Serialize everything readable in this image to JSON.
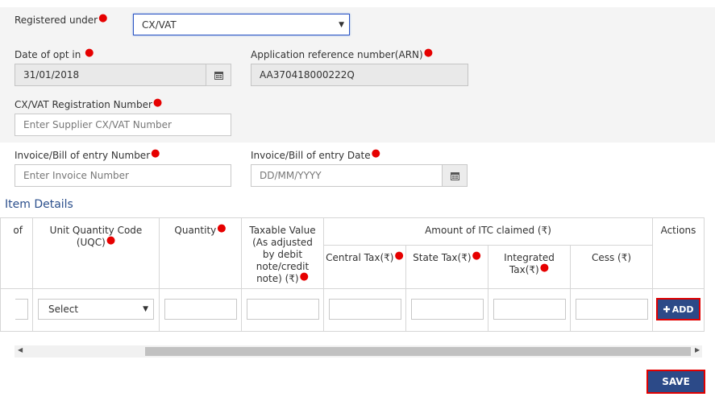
{
  "form": {
    "registered_under": {
      "label": "Registered under",
      "value": "CX/VAT"
    },
    "date_of_opt_in": {
      "label": "Date of opt in",
      "value": "31/01/2018"
    },
    "arn": {
      "label": "Application reference number(ARN)",
      "value": "AA370418000222Q"
    },
    "cx_vat_reg": {
      "label": "CX/VAT Registration Number",
      "placeholder": "Enter Supplier CX/VAT Number"
    },
    "invoice_number": {
      "label": "Invoice/Bill of entry Number",
      "placeholder": "Enter Invoice Number"
    },
    "invoice_date": {
      "label": "Invoice/Bill of entry Date",
      "placeholder": "DD/MM/YYYY"
    }
  },
  "item_details": {
    "title": "Item Details",
    "headers": {
      "col_partial": "of",
      "uqc": "Unit Quantity Code (UQC)",
      "quantity": "Quantity",
      "taxable_value": "Taxable Value (As adjusted by debit note/credit note) (₹)",
      "itc_group": "Amount of ITC claimed (₹)",
      "central_tax": "Central Tax(₹)",
      "state_tax": "State Tax(₹)",
      "integrated_tax": "Integrated Tax(₹)",
      "cess": "Cess (₹)",
      "actions": "Actions"
    },
    "uqc_select_value": "Select",
    "add_button": "ADD"
  },
  "buttons": {
    "save": "SAVE"
  },
  "colors": {
    "primary": "#2c4a88",
    "required": "#e60000",
    "highlight_border": "#e00000"
  }
}
